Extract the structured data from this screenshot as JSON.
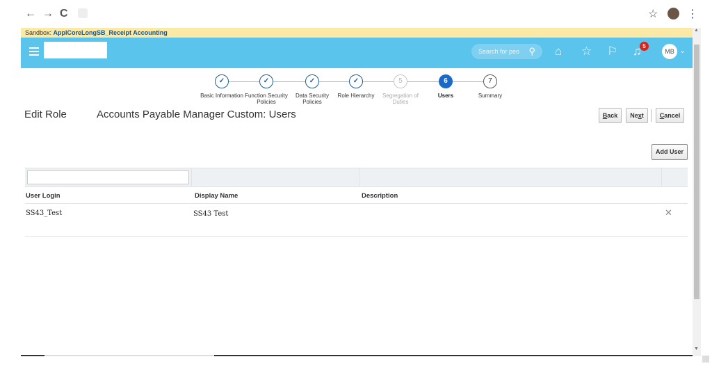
{
  "browser": {
    "back_icon": "←",
    "forward_icon": "→",
    "reload_icon": "C",
    "lock_icon": "🔒",
    "star_icon": "☆",
    "menu_icon": "⋮"
  },
  "sandbox": {
    "prefix": "Sandbox:",
    "name": "ApplCoreLongSB_Receipt Accounting"
  },
  "header": {
    "search_placeholder": "Search for peo",
    "notifications_count": "5",
    "user_initials": "MB",
    "icons": [
      "search-icon",
      "home-icon",
      "star-icon",
      "flag-icon",
      "bell-icon"
    ]
  },
  "train": {
    "steps": [
      {
        "num": "✓",
        "label": "Basic Information",
        "state": "done"
      },
      {
        "num": "✓",
        "label": "Function Security Policies",
        "state": "done"
      },
      {
        "num": "✓",
        "label": "Data Security Policies",
        "state": "done"
      },
      {
        "num": "✓",
        "label": "Role Hierarchy",
        "state": "done"
      },
      {
        "num": "5",
        "label": "Segregation of Duties",
        "state": "disabled"
      },
      {
        "num": "6",
        "label": "Users",
        "state": "current"
      },
      {
        "num": "7",
        "label": "Summary",
        "state": "todo"
      }
    ]
  },
  "page": {
    "section": "Edit Role",
    "title": "Accounts Payable Manager Custom: Users"
  },
  "buttons": {
    "back_first": "B",
    "back_rest": "ack",
    "next_first": "Ne",
    "next_u": "x",
    "next_rest": "t",
    "cancel_first": "C",
    "cancel_rest": "ancel",
    "add_user": "Add User"
  },
  "table": {
    "columns": [
      "User Login",
      "Display Name",
      "Description"
    ],
    "rows": [
      {
        "user_login": "SS43_Test",
        "display_name": "SS43 Test",
        "description": ""
      }
    ],
    "remove_icon": "✕"
  },
  "colors": {
    "header": "#5bc4ec",
    "sandbox_banner": "#fbe9a8",
    "current_step": "#1b6ac9",
    "badge": "#d9231d"
  }
}
